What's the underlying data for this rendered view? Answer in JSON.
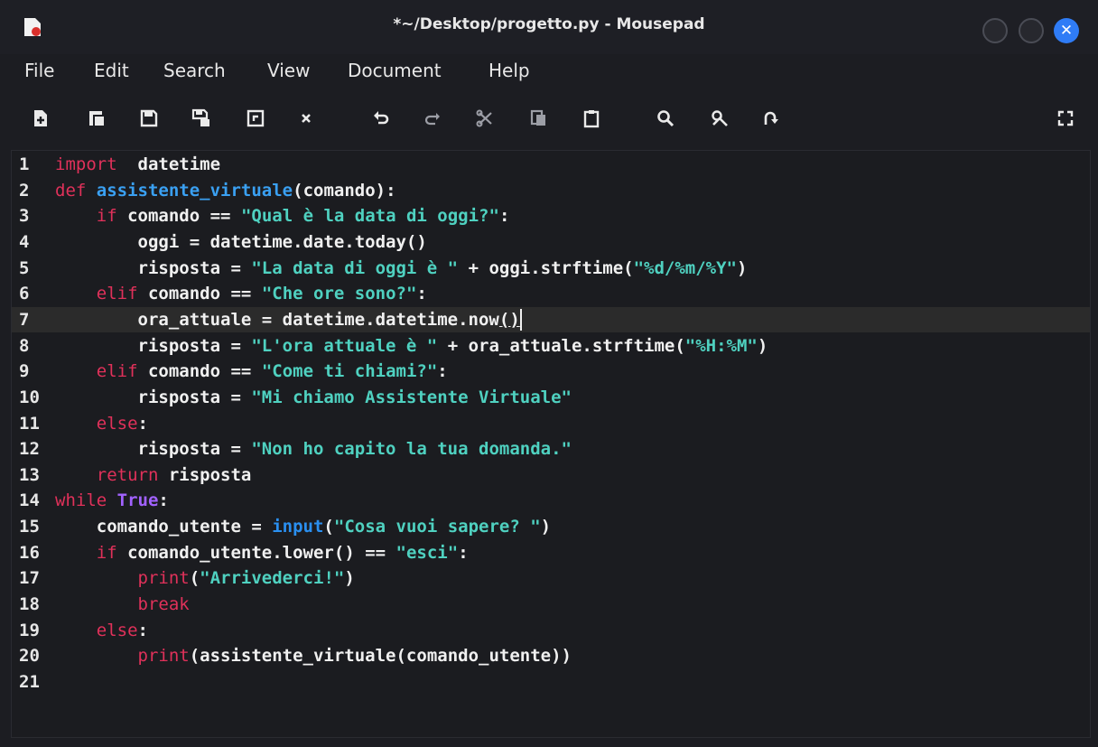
{
  "window": {
    "title": "*~/Desktop/progetto.py - Mousepad",
    "close_glyph": "✕"
  },
  "menu": [
    "File",
    "Edit",
    "Search",
    "View",
    "Document",
    "Help"
  ],
  "toolbar_icons": [
    "new-document-icon",
    "new-window-icon",
    "save-icon",
    "save-as-icon",
    "revert-icon",
    "close-tab-icon",
    "undo-icon",
    "redo-icon",
    "cut-icon",
    "copy-icon",
    "paste-icon",
    "find-icon",
    "find-replace-icon",
    "goto-line-icon",
    "fullscreen-icon"
  ],
  "editor": {
    "current_line": 7,
    "lines": [
      {
        "n": "1",
        "tokens": [
          [
            "kw",
            "import"
          ],
          [
            "",
            "  datetime"
          ]
        ]
      },
      {
        "n": "2",
        "tokens": [
          [
            "kw",
            "def"
          ],
          [
            "",
            " "
          ],
          [
            "fn",
            "assistente_virtuale"
          ],
          [
            "",
            "(comando):"
          ]
        ]
      },
      {
        "n": "3",
        "tokens": [
          [
            "",
            "    "
          ],
          [
            "kw",
            "if"
          ],
          [
            "",
            " comando "
          ],
          [
            "",
            "=="
          ],
          [
            "",
            " "
          ],
          [
            "st",
            "\"Qual è la data di oggi?\""
          ],
          [
            "",
            ":"
          ]
        ]
      },
      {
        "n": "4",
        "tokens": [
          [
            "",
            "        oggi = datetime.date.today()"
          ]
        ]
      },
      {
        "n": "5",
        "tokens": [
          [
            "",
            "        risposta = "
          ],
          [
            "st",
            "\"La data di oggi è \""
          ],
          [
            "",
            " + oggi.strftime("
          ],
          [
            "st",
            "\"%d/%m/%Y\""
          ],
          [
            "",
            ")"
          ]
        ]
      },
      {
        "n": "6",
        "tokens": [
          [
            "",
            "    "
          ],
          [
            "kw",
            "elif"
          ],
          [
            "",
            " comando "
          ],
          [
            "",
            "=="
          ],
          [
            "",
            " "
          ],
          [
            "st",
            "\"Che ore sono?\""
          ],
          [
            "",
            ":"
          ]
        ]
      },
      {
        "n": "7",
        "tokens": [
          [
            "",
            "        ora_attuale = datetime.datetime.now"
          ],
          [
            "u",
            "()"
          ],
          [
            "caret",
            ""
          ]
        ]
      },
      {
        "n": "8",
        "tokens": [
          [
            "",
            "        risposta = "
          ],
          [
            "st",
            "\"L'ora attuale è \""
          ],
          [
            "",
            " + ora_attuale.strftime("
          ],
          [
            "st",
            "\"%H:%M\""
          ],
          [
            "",
            ")"
          ]
        ]
      },
      {
        "n": "9",
        "tokens": [
          [
            "",
            "    "
          ],
          [
            "kw",
            "elif"
          ],
          [
            "",
            " comando "
          ],
          [
            "",
            "=="
          ],
          [
            "",
            " "
          ],
          [
            "st",
            "\"Come ti chiami?\""
          ],
          [
            "",
            ":"
          ]
        ]
      },
      {
        "n": "10",
        "tokens": [
          [
            "",
            "        risposta = "
          ],
          [
            "st",
            "\"Mi chiamo Assistente Virtuale\""
          ]
        ]
      },
      {
        "n": "11",
        "tokens": [
          [
            "",
            "    "
          ],
          [
            "kw",
            "else"
          ],
          [
            "",
            ":"
          ]
        ]
      },
      {
        "n": "12",
        "tokens": [
          [
            "",
            "        risposta = "
          ],
          [
            "st",
            "\"Non ho capito la tua domanda.\""
          ]
        ]
      },
      {
        "n": "13",
        "tokens": [
          [
            "",
            "    "
          ],
          [
            "kw",
            "return"
          ],
          [
            "",
            " risposta"
          ]
        ]
      },
      {
        "n": "14",
        "tokens": [
          [
            "kw",
            "while"
          ],
          [
            "",
            " "
          ],
          [
            "tr",
            "True"
          ],
          [
            "",
            ":"
          ]
        ]
      },
      {
        "n": "15",
        "tokens": [
          [
            "",
            "    comando_utente = "
          ],
          [
            "bi",
            "input"
          ],
          [
            "",
            "("
          ],
          [
            "st",
            "\"Cosa vuoi sapere? \""
          ],
          [
            "",
            ")"
          ]
        ]
      },
      {
        "n": "16",
        "tokens": [
          [
            "",
            "    "
          ],
          [
            "kw",
            "if"
          ],
          [
            "",
            " comando_utente.lower() "
          ],
          [
            "",
            "=="
          ],
          [
            "",
            " "
          ],
          [
            "st",
            "\"esci\""
          ],
          [
            "",
            ":"
          ]
        ]
      },
      {
        "n": "17",
        "tokens": [
          [
            "",
            "        "
          ],
          [
            "kw",
            "print"
          ],
          [
            "",
            "("
          ],
          [
            "st",
            "\"Arrivederci!\""
          ],
          [
            "",
            ")"
          ]
        ]
      },
      {
        "n": "18",
        "tokens": [
          [
            "",
            "        "
          ],
          [
            "kw",
            "break"
          ]
        ]
      },
      {
        "n": "19",
        "tokens": [
          [
            "",
            "    "
          ],
          [
            "kw",
            "else"
          ],
          [
            "",
            ":"
          ]
        ]
      },
      {
        "n": "20",
        "tokens": [
          [
            "",
            "        "
          ],
          [
            "kw",
            "print"
          ],
          [
            "",
            "(assistente_virtuale(comando_utente))"
          ]
        ]
      },
      {
        "n": "21",
        "tokens": []
      }
    ]
  }
}
